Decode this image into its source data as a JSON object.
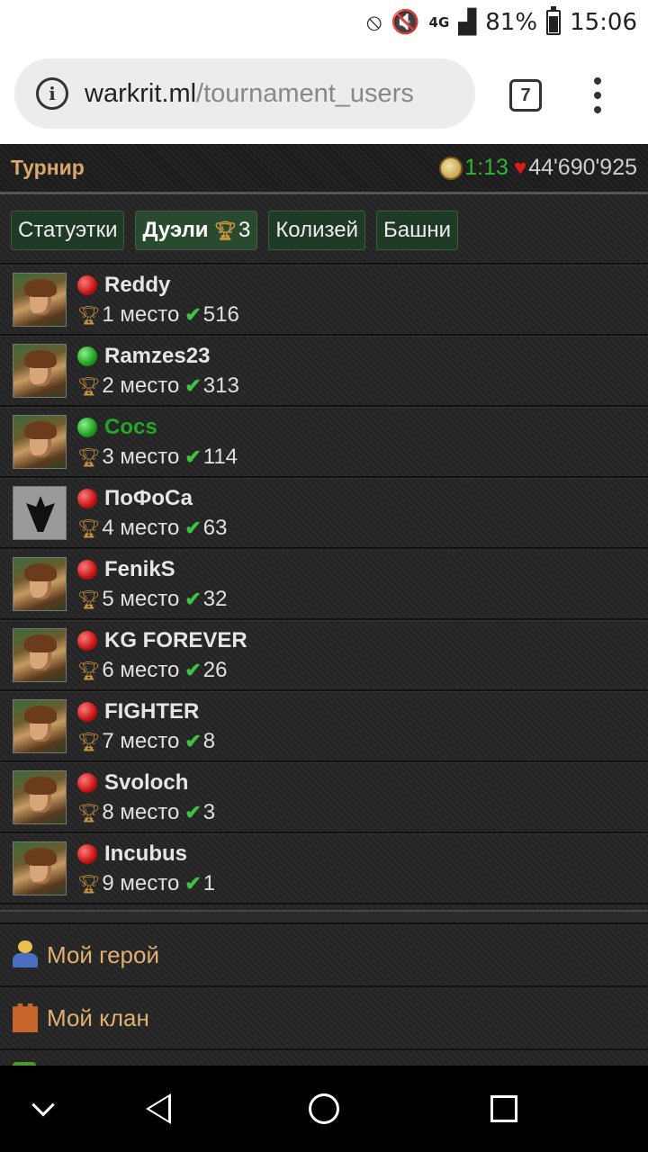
{
  "status_bar": {
    "network": "4G",
    "battery": "81%",
    "time": "15:06"
  },
  "browser": {
    "url_host": "warkrit.ml",
    "url_path": "/tournament_users",
    "tab_count": "7"
  },
  "header": {
    "title": "Турнир",
    "timer": "1:13",
    "hp": "44'690'925"
  },
  "tabs": [
    {
      "label": "Статуэтки"
    },
    {
      "label": "Дуэли",
      "count": "3"
    },
    {
      "label": "Колизей"
    },
    {
      "label": "Башни"
    }
  ],
  "players": [
    {
      "name": "Reddy",
      "status": "red",
      "place": "1 место",
      "score": "516",
      "avatar": "hero"
    },
    {
      "name": "Ramzes23",
      "status": "green",
      "place": "2 место",
      "score": "313",
      "avatar": "hero"
    },
    {
      "name": "Cocs",
      "status": "green",
      "place": "3 место",
      "score": "114",
      "avatar": "hero"
    },
    {
      "name": "ПоФоСа",
      "status": "red",
      "place": "4 место",
      "score": "63",
      "avatar": "dark"
    },
    {
      "name": "FenikS",
      "status": "red",
      "place": "5 место",
      "score": "32",
      "avatar": "hero"
    },
    {
      "name": "KG FOREVER",
      "status": "red",
      "place": "6 место",
      "score": "26",
      "avatar": "hero"
    },
    {
      "name": "FIGHTER",
      "status": "red",
      "place": "7 место",
      "score": "8",
      "avatar": "hero"
    },
    {
      "name": "Svoloch",
      "status": "red",
      "place": "8 место",
      "score": "3",
      "avatar": "hero"
    },
    {
      "name": "Incubus",
      "status": "red",
      "place": "9 место",
      "score": "1",
      "avatar": "hero"
    }
  ],
  "menu": [
    {
      "label": "Мой герой",
      "icon": "hero-icon"
    },
    {
      "label": "Мой клан",
      "icon": "castle-icon"
    }
  ],
  "colors": {
    "accent_gold": "#d9a86a",
    "online_green": "#24a824",
    "tab_green": "#1f3a25"
  }
}
